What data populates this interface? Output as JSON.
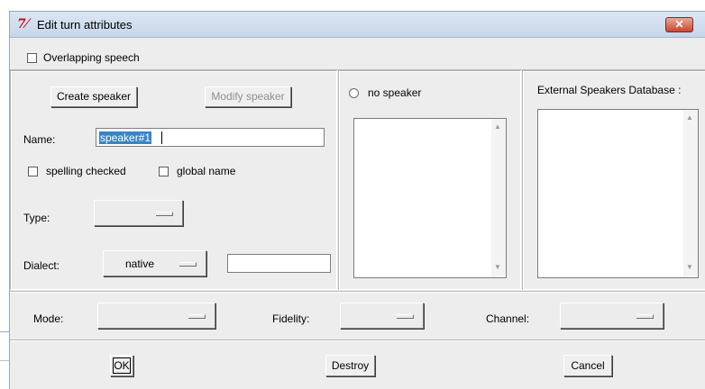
{
  "window": {
    "title": "Edit turn attributes",
    "close_label": "x"
  },
  "overlapping_speech": {
    "label": "Overlapping speech",
    "checked": false
  },
  "speaker": {
    "create_label": "Create speaker",
    "modify_label": "Modify speaker",
    "name_label": "Name:",
    "name_value": "speaker#1",
    "spelling_label": "spelling checked",
    "global_label": "global name",
    "type_label": "Type:",
    "dialect_label": "Dialect:",
    "dialect_value": "native",
    "dialect_extra": ""
  },
  "speaker_list": {
    "no_speaker_label": "no speaker"
  },
  "external_db": {
    "label": "External Speakers Database :"
  },
  "bottom": {
    "mode_label": "Mode:",
    "fidelity_label": "Fidelity:",
    "channel_label": "Channel:"
  },
  "actions": {
    "ok_label": "OK",
    "destroy_label": "Destroy",
    "cancel_label": "Cancel"
  }
}
